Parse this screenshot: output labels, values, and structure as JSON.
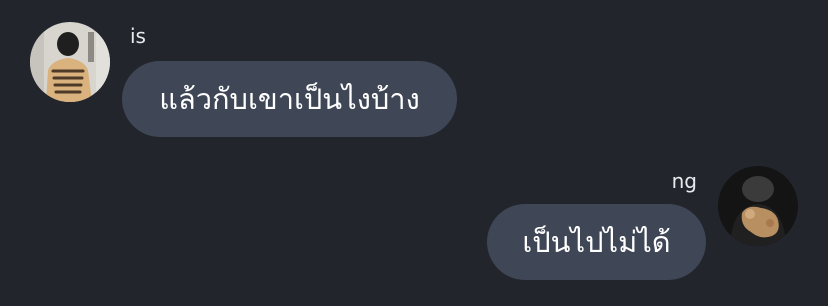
{
  "conversation": {
    "messages": [
      {
        "sender": "is",
        "side": "left",
        "avatar": "user-avatar-love-has-many-faces-icon",
        "text": "แล้วกับเขาเป็นไงบ้าง"
      },
      {
        "sender": "ng",
        "side": "right",
        "avatar": "user-avatar-holding-dog-icon",
        "text": "เป็นไปไม่ได้"
      }
    ]
  },
  "colors": {
    "background": "#23252d",
    "bubble": "#3f4656",
    "text": "#ffffff"
  }
}
